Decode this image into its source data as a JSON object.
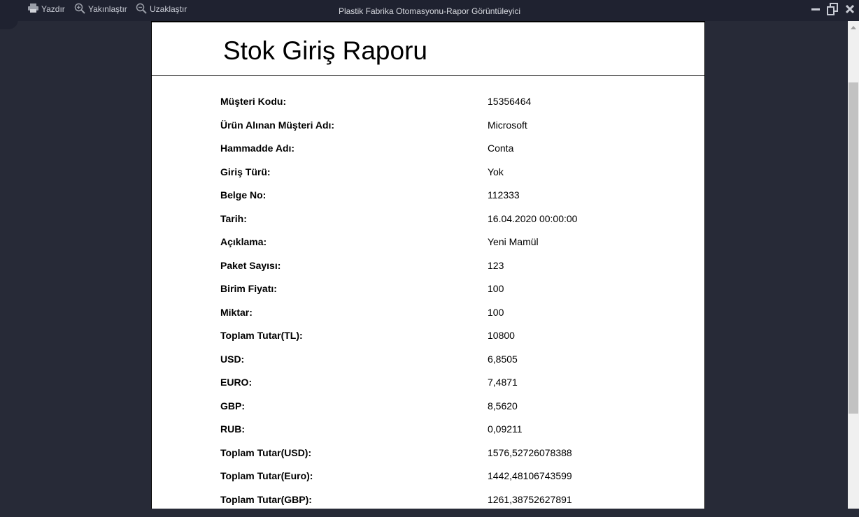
{
  "toolbar": {
    "print_label": "Yazdır",
    "zoom_in_label": "Yakınlaştır",
    "zoom_out_label": "Uzaklaştır"
  },
  "window": {
    "title": "Plastik Fabrika Otomasyonu-Rapor Görüntüleyici"
  },
  "report": {
    "title": "Stok Giriş Raporu",
    "fields": [
      {
        "label": "Müşteri Kodu:",
        "value": "15356464"
      },
      {
        "label": "Ürün Alınan Müşteri Adı:",
        "value": "Microsoft"
      },
      {
        "label": "Hammadde Adı:",
        "value": "Conta"
      },
      {
        "label": "Giriş Türü:",
        "value": "Yok"
      },
      {
        "label": "Belge No:",
        "value": "112333"
      },
      {
        "label": "Tarih:",
        "value": "16.04.2020 00:00:00"
      },
      {
        "label": "Açıklama:",
        "value": "Yeni Mamül"
      },
      {
        "label": "Paket Sayısı:",
        "value": "123"
      },
      {
        "label": "Birim Fiyatı:",
        "value": "100"
      },
      {
        "label": "Miktar:",
        "value": "100"
      },
      {
        "label": "Toplam Tutar(TL):",
        "value": "10800"
      },
      {
        "label": "USD:",
        "value": "6,8505"
      },
      {
        "label": "EURO:",
        "value": "7,4871"
      },
      {
        "label": "GBP:",
        "value": "8,5620"
      },
      {
        "label": "RUB:",
        "value": "0,09211"
      },
      {
        "label": "Toplam Tutar(USD):",
        "value": "1576,52726078388"
      },
      {
        "label": "Toplam Tutar(Euro):",
        "value": "1442,48106743599"
      },
      {
        "label": "Toplam Tutar(GBP):",
        "value": "1261,38752627891"
      }
    ]
  },
  "colors": {
    "chrome_bg": "#1f2230",
    "workspace_bg": "#272a37",
    "page_bg": "#ffffff"
  }
}
